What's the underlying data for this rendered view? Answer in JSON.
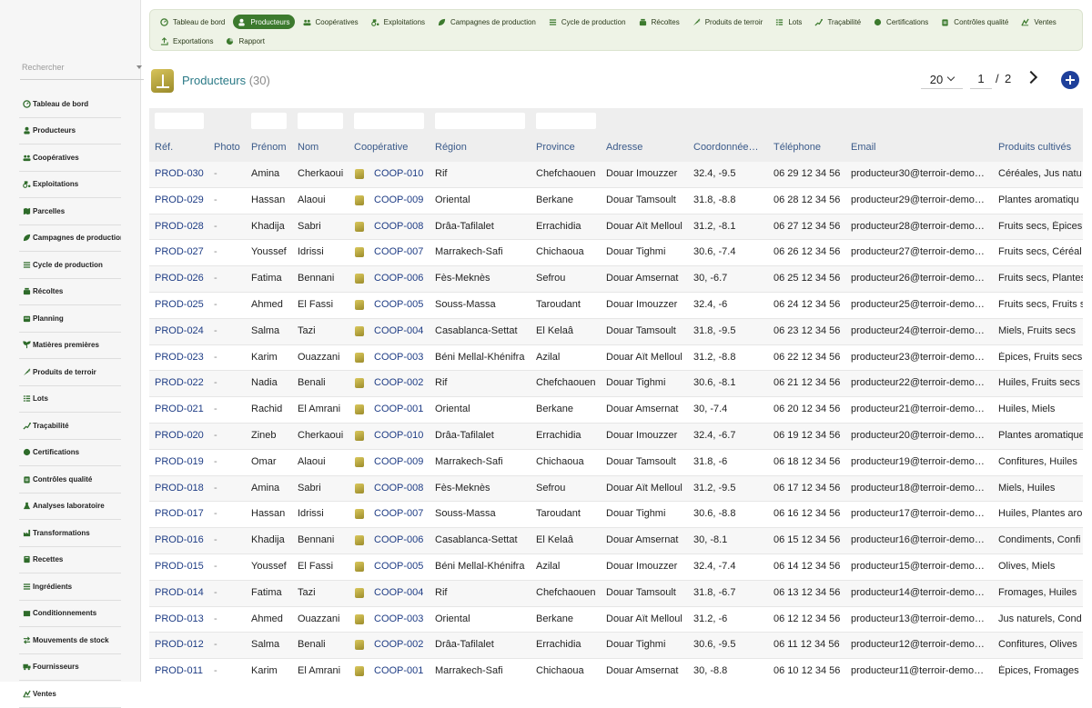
{
  "sidebar": {
    "search_placeholder": "Rechercher",
    "items": [
      {
        "label": "Tableau de bord",
        "icon": "dashboard-icon"
      },
      {
        "label": "Producteurs",
        "icon": "user-icon"
      },
      {
        "label": "Coopératives",
        "icon": "group-icon"
      },
      {
        "label": "Exploitations",
        "icon": "tractor-icon"
      },
      {
        "label": "Parcelles",
        "icon": "map-icon"
      },
      {
        "label": "Campagnes de production",
        "icon": "leaf-icon"
      },
      {
        "label": "Cycle de production",
        "icon": "list-icon"
      },
      {
        "label": "Récoltes",
        "icon": "basket-icon"
      },
      {
        "label": "Planning",
        "icon": "calendar-icon"
      },
      {
        "label": "Matières premières",
        "icon": "seedling-icon"
      },
      {
        "label": "Produits de terroir",
        "icon": "carrot-icon"
      },
      {
        "label": "Lots",
        "icon": "lots-icon"
      },
      {
        "label": "Traçabilité",
        "icon": "trace-icon"
      },
      {
        "label": "Certifications",
        "icon": "certificate-icon"
      },
      {
        "label": "Contrôles qualité",
        "icon": "clipboard-icon"
      },
      {
        "label": "Analyses laboratoire",
        "icon": "flask-icon"
      },
      {
        "label": "Transformations",
        "icon": "factory-icon"
      },
      {
        "label": "Recettes",
        "icon": "book-icon"
      },
      {
        "label": "Ingrédients",
        "icon": "ingredients-icon"
      },
      {
        "label": "Conditionnements",
        "icon": "box-icon"
      },
      {
        "label": "Mouvements de stock",
        "icon": "arrows-icon"
      },
      {
        "label": "Fournisseurs",
        "icon": "truck-icon"
      },
      {
        "label": "Ventes",
        "icon": "sales-icon"
      }
    ]
  },
  "topnav": {
    "row1": [
      {
        "label": "Tableau de bord",
        "icon": "dashboard-icon",
        "active": false
      },
      {
        "label": "Producteurs",
        "icon": "user-icon",
        "active": true
      },
      {
        "label": "Coopératives",
        "icon": "group-icon",
        "active": false
      },
      {
        "label": "Exploitations",
        "icon": "tractor-icon",
        "active": false
      },
      {
        "label": "Campagnes de production",
        "icon": "leaf-icon",
        "active": false
      },
      {
        "label": "Cycle de production",
        "icon": "list-icon",
        "active": false
      },
      {
        "label": "Récoltes",
        "icon": "basket-icon",
        "active": false
      },
      {
        "label": "Produits de terroir",
        "icon": "carrot-icon",
        "active": false
      },
      {
        "label": "Lots",
        "icon": "lots-icon",
        "active": false
      },
      {
        "label": "Traçabilité",
        "icon": "trace-icon",
        "active": false
      },
      {
        "label": "Certifications",
        "icon": "certificate-icon",
        "active": false
      },
      {
        "label": "Contrôles qualité",
        "icon": "clipboard-icon",
        "active": false
      },
      {
        "label": "Ventes",
        "icon": "sales-icon",
        "active": false
      }
    ],
    "row2": [
      {
        "label": "Exportations",
        "icon": "export-icon",
        "active": false
      },
      {
        "label": "Rapport",
        "icon": "chart-icon",
        "active": false
      }
    ]
  },
  "header": {
    "title": "Producteurs",
    "count": "(30)"
  },
  "pager": {
    "page_size": "20",
    "current_page": "1",
    "separator": "/",
    "total_pages": "2"
  },
  "colors": {
    "accent": "#3c7a2e",
    "link": "#1f3d85",
    "title": "#2b7a87",
    "add_button": "#1e3f9a"
  },
  "table": {
    "columns": [
      "Réf.",
      "Photo",
      "Prénom",
      "Nom",
      "Coopérative",
      "Région",
      "Province",
      "Adresse",
      "Coordonnée…",
      "Téléphone",
      "Email",
      "Produits cultivés"
    ],
    "rows": [
      [
        "PROD-030",
        "-",
        "Amina",
        "Cherkaoui",
        "COOP-010",
        "Rif",
        "Chefchaouen",
        "Douar Imouzzer",
        "32.4, -9.5",
        "06 29 12 34 56",
        "producteur30@terroir-demo…",
        "Céréales, Jus natu"
      ],
      [
        "PROD-029",
        "-",
        "Hassan",
        "Alaoui",
        "COOP-009",
        "Oriental",
        "Berkane",
        "Douar Tamsoult",
        "31.8, -8.8",
        "06 28 12 34 56",
        "producteur29@terroir-demo…",
        "Plantes aromatiqu"
      ],
      [
        "PROD-028",
        "-",
        "Khadija",
        "Sabri",
        "COOP-008",
        "Drâa-Tafilalet",
        "Errachidia",
        "Douar Aït Melloul",
        "31.2, -8.1",
        "06 27 12 34 56",
        "producteur28@terroir-demo…",
        "Fruits secs, Épices"
      ],
      [
        "PROD-027",
        "-",
        "Youssef",
        "Idrissi",
        "COOP-007",
        "Marrakech-Safi",
        "Chichaoua",
        "Douar Tighmi",
        "30.6, -7.4",
        "06 26 12 34 56",
        "producteur27@terroir-demo…",
        "Fruits secs, Céréal"
      ],
      [
        "PROD-026",
        "-",
        "Fatima",
        "Bennani",
        "COOP-006",
        "Fès-Meknès",
        "Sefrou",
        "Douar Amsernat",
        "30, -6.7",
        "06 25 12 34 56",
        "producteur26@terroir-demo…",
        "Fruits secs, Plantes"
      ],
      [
        "PROD-025",
        "-",
        "Ahmed",
        "El Fassi",
        "COOP-005",
        "Souss-Massa",
        "Taroudant",
        "Douar Imouzzer",
        "32.4, -6",
        "06 24 12 34 56",
        "producteur25@terroir-demo…",
        "Fruits secs, Fruits s"
      ],
      [
        "PROD-024",
        "-",
        "Salma",
        "Tazi",
        "COOP-004",
        "Casablanca-Settat",
        "El Kelaâ",
        "Douar Tamsoult",
        "31.8, -9.5",
        "06 23 12 34 56",
        "producteur24@terroir-demo…",
        "Miels, Fruits secs"
      ],
      [
        "PROD-023",
        "-",
        "Karim",
        "Ouazzani",
        "COOP-003",
        "Béni Mellal-Khénifra",
        "Azilal",
        "Douar Aït Melloul",
        "31.2, -8.8",
        "06 22 12 34 56",
        "producteur23@terroir-demo…",
        "Épices, Fruits secs"
      ],
      [
        "PROD-022",
        "-",
        "Nadia",
        "Benali",
        "COOP-002",
        "Rif",
        "Chefchaouen",
        "Douar Tighmi",
        "30.6, -8.1",
        "06 21 12 34 56",
        "producteur22@terroir-demo…",
        "Huiles, Fruits secs"
      ],
      [
        "PROD-021",
        "-",
        "Rachid",
        "El Amrani",
        "COOP-001",
        "Oriental",
        "Berkane",
        "Douar Amsernat",
        "30, -7.4",
        "06 20 12 34 56",
        "producteur21@terroir-demo…",
        "Huiles, Miels"
      ],
      [
        "PROD-020",
        "-",
        "Zineb",
        "Cherkaoui",
        "COOP-010",
        "Drâa-Tafilalet",
        "Errachidia",
        "Douar Imouzzer",
        "32.4, -6.7",
        "06 19 12 34 56",
        "producteur20@terroir-demo…",
        "Plantes aromatique"
      ],
      [
        "PROD-019",
        "-",
        "Omar",
        "Alaoui",
        "COOP-009",
        "Marrakech-Safi",
        "Chichaoua",
        "Douar Tamsoult",
        "31.8, -6",
        "06 18 12 34 56",
        "producteur19@terroir-demo…",
        "Confitures, Huiles"
      ],
      [
        "PROD-018",
        "-",
        "Amina",
        "Sabri",
        "COOP-008",
        "Fès-Meknès",
        "Sefrou",
        "Douar Aït Melloul",
        "31.2, -9.5",
        "06 17 12 34 56",
        "producteur18@terroir-demo…",
        "Miels, Huiles"
      ],
      [
        "PROD-017",
        "-",
        "Hassan",
        "Idrissi",
        "COOP-007",
        "Souss-Massa",
        "Taroudant",
        "Douar Tighmi",
        "30.6, -8.8",
        "06 16 12 34 56",
        "producteur17@terroir-demo…",
        "Huiles, Plantes aro"
      ],
      [
        "PROD-016",
        "-",
        "Khadija",
        "Bennani",
        "COOP-006",
        "Casablanca-Settat",
        "El Kelaâ",
        "Douar Amsernat",
        "30, -8.1",
        "06 15 12 34 56",
        "producteur16@terroir-demo…",
        "Condiments, Confi"
      ],
      [
        "PROD-015",
        "-",
        "Youssef",
        "El Fassi",
        "COOP-005",
        "Béni Mellal-Khénifra",
        "Azilal",
        "Douar Imouzzer",
        "32.4, -7.4",
        "06 14 12 34 56",
        "producteur15@terroir-demo…",
        "Olives, Miels"
      ],
      [
        "PROD-014",
        "-",
        "Fatima",
        "Tazi",
        "COOP-004",
        "Rif",
        "Chefchaouen",
        "Douar Tamsoult",
        "31.8, -6.7",
        "06 13 12 34 56",
        "producteur14@terroir-demo…",
        "Fromages, Huiles"
      ],
      [
        "PROD-013",
        "-",
        "Ahmed",
        "Ouazzani",
        "COOP-003",
        "Oriental",
        "Berkane",
        "Douar Aït Melloul",
        "31.2, -6",
        "06 12 12 34 56",
        "producteur13@terroir-demo…",
        "Jus naturels, Cond"
      ],
      [
        "PROD-012",
        "-",
        "Salma",
        "Benali",
        "COOP-002",
        "Drâa-Tafilalet",
        "Errachidia",
        "Douar Tighmi",
        "30.6, -9.5",
        "06 11 12 34 56",
        "producteur12@terroir-demo…",
        "Confitures, Olives"
      ],
      [
        "PROD-011",
        "-",
        "Karim",
        "El Amrani",
        "COOP-001",
        "Marrakech-Safi",
        "Chichaoua",
        "Douar Amsernat",
        "30, -8.8",
        "06 10 12 34 56",
        "producteur11@terroir-demo…",
        "Épices, Fromages"
      ]
    ]
  }
}
